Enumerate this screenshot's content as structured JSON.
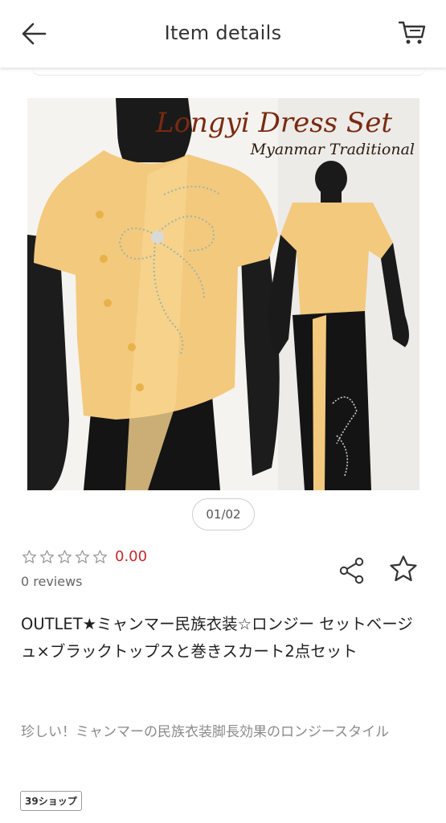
{
  "header": {
    "title": "Item details",
    "back_icon": "arrow-left-icon",
    "cart_icon": "cart-icon"
  },
  "gallery": {
    "banner_title": "Longyi Dress Set",
    "banner_subtitle": "Myanmar Traditional",
    "pager": "01/02"
  },
  "rating": {
    "stars_filled": 0,
    "stars_total": 5,
    "value": "0.00",
    "reviews": "0 reviews"
  },
  "actions": {
    "share_icon": "share-icon",
    "favorite_icon": "star-outline-icon"
  },
  "product": {
    "title": "OUTLET★ミャンマー民族衣装☆ロンジー セットベージュ×ブラックトップスと巻きスカート2点セット",
    "description": "珍しい！ミャンマーの民族衣装脚長効果のロンジースタイル",
    "shop_badge": "39ショップ"
  },
  "colors": {
    "price": "#c2292b",
    "blouse": "#f3c97e",
    "skirt": "#141414",
    "banner_text": "#7a2a10"
  }
}
